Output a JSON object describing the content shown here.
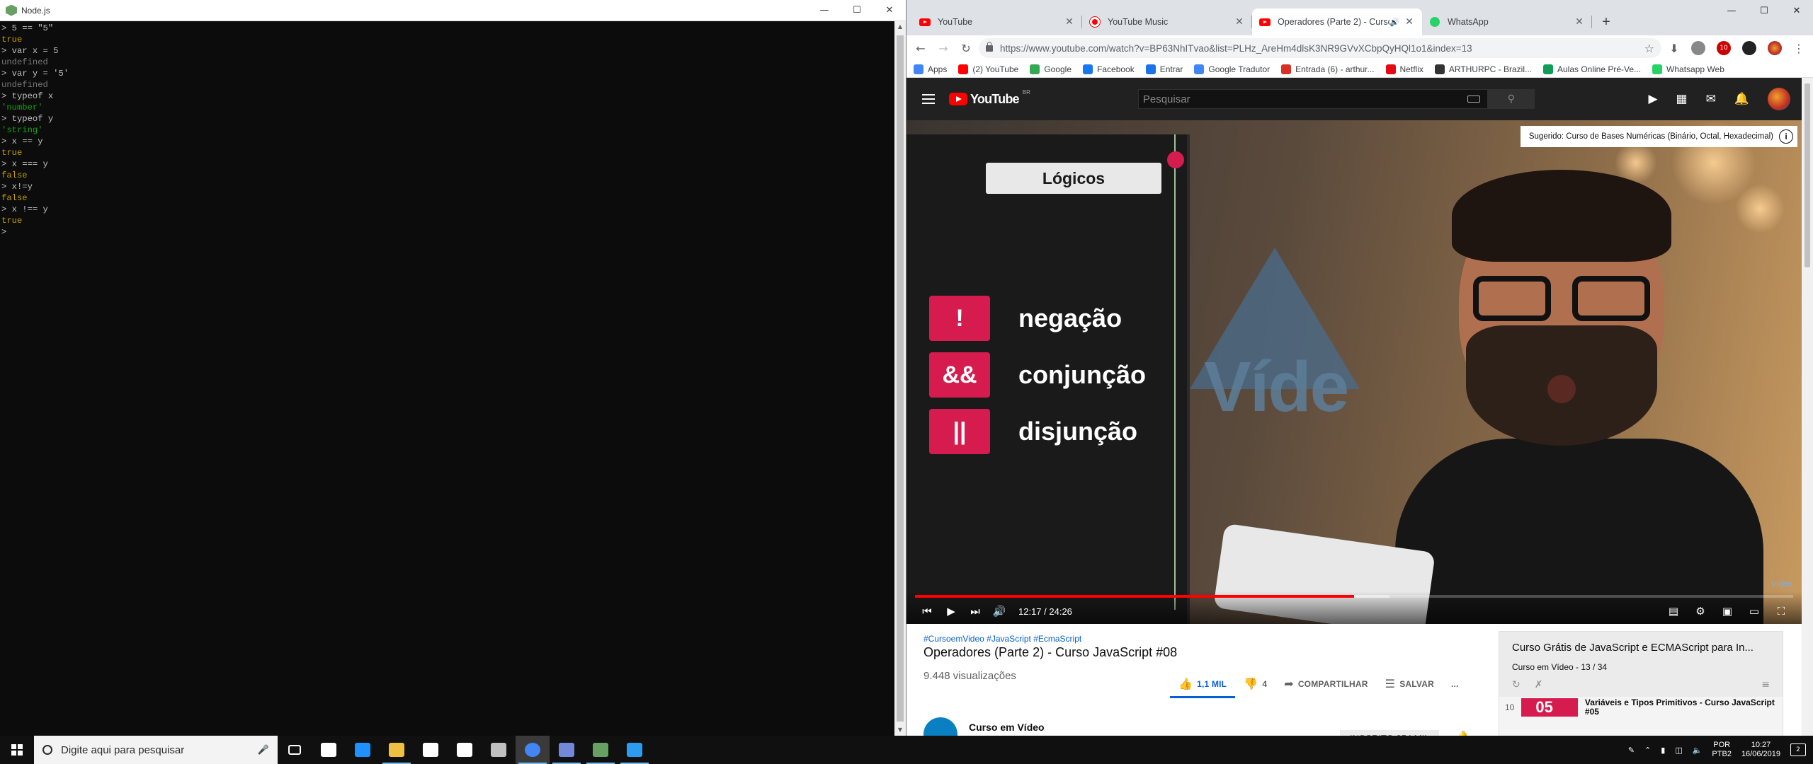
{
  "node": {
    "title": "Node.js",
    "lines": [
      {
        "text": "> 5 == \"5\"",
        "cls": ""
      },
      {
        "text": "true",
        "cls": "c-yellow"
      },
      {
        "text": "> var x = 5",
        "cls": ""
      },
      {
        "text": "undefined",
        "cls": "c-gray"
      },
      {
        "text": "> var y = '5'",
        "cls": ""
      },
      {
        "text": "undefined",
        "cls": "c-gray"
      },
      {
        "text": "> typeof x",
        "cls": ""
      },
      {
        "text": "'number'",
        "cls": "c-green"
      },
      {
        "text": "> typeof y",
        "cls": ""
      },
      {
        "text": "'string'",
        "cls": "c-green"
      },
      {
        "text": "> x == y",
        "cls": ""
      },
      {
        "text": "true",
        "cls": "c-yellow"
      },
      {
        "text": "> x === y",
        "cls": ""
      },
      {
        "text": "false",
        "cls": "c-yellow"
      },
      {
        "text": "> x!=y",
        "cls": ""
      },
      {
        "text": "false",
        "cls": "c-yellow"
      },
      {
        "text": "> x !== y",
        "cls": ""
      },
      {
        "text": "true",
        "cls": "c-yellow"
      },
      {
        "text": "> ",
        "cls": ""
      }
    ]
  },
  "chrome": {
    "tabs": [
      {
        "label": "YouTube",
        "fav": "yt"
      },
      {
        "label": "YouTube Music",
        "fav": "ytm"
      },
      {
        "label": "Operadores (Parte 2) - Curso JavaScript #08",
        "fav": "yt",
        "active": true
      },
      {
        "label": "WhatsApp",
        "fav": "wa"
      }
    ],
    "new_tab": "+",
    "url": "https://www.youtube.com/watch?v=BP63NhITvao&list=PLHz_AreHm4dlsK3NR9GVvXCbpQyHQl1o1&index=13",
    "bookmarks": [
      {
        "label": "Apps",
        "color": "#4285f4"
      },
      {
        "label": "(2) YouTube",
        "color": "#ff0000"
      },
      {
        "label": "Google",
        "color": "#34a853"
      },
      {
        "label": "Facebook",
        "color": "#1877f2"
      },
      {
        "label": "Entrar",
        "color": "#1a73e8"
      },
      {
        "label": "Google Tradutor",
        "color": "#4285f4"
      },
      {
        "label": "Entrada (6) - arthur...",
        "color": "#d93025"
      },
      {
        "label": "Netflix",
        "color": "#e50914"
      },
      {
        "label": "ARTHURPC - Brazil...",
        "color": "#333333"
      },
      {
        "label": "Aulas Online Pré-Ve...",
        "color": "#0f9d58"
      },
      {
        "label": "Whatsapp Web",
        "color": "#25d366"
      }
    ],
    "ext_badge": "10"
  },
  "youtube": {
    "logo": "YouTube",
    "logo_region": "BR",
    "search_placeholder": "Pesquisar",
    "suggest": "Sugerido: Curso de Bases Numéricas (Binário, Octal, Hexadecimal)",
    "slide": {
      "title": "Lógicos",
      "ops": [
        {
          "sym": "!",
          "label": "negação"
        },
        {
          "sym": "&&",
          "label": "conjunção"
        },
        {
          "sym": "||",
          "label": "disjunção"
        }
      ],
      "bg_text": "Víde",
      "watermark": "Vídeo"
    },
    "time": "12:17 / 24:26",
    "played_fraction": 0.5,
    "buffered_fraction": 0.54,
    "hashtags": "#CursoemVideo #JavaScript #EcmaScript",
    "title": "Operadores (Parte 2) - Curso JavaScript #08",
    "views": "9.448 visualizações",
    "likes": "1,1 MIL",
    "dislikes": "4",
    "share": "COMPARTILHAR",
    "save": "SALVAR",
    "more": "...",
    "channel": "Curso em Vídeo",
    "subscribe": "INSCRITO  854 MIL",
    "playlist": {
      "title": "Curso Grátis de JavaScript e ECMAScript para In...",
      "sub": "Curso em Vídeo - 13 / 34",
      "item_index": "10",
      "item_thumb": "05",
      "item_title": "Variáveis e Tipos Primitivos - Curso JavaScript #05"
    }
  },
  "taskbar": {
    "search_placeholder": "Digite aqui para pesquisar",
    "lang_top": "POR",
    "lang_bottom": "PTB2",
    "time": "10:27",
    "date": "16/06/2019",
    "notif_count": "2",
    "apps": [
      {
        "name": "task-view",
        "color": "#ffffff"
      },
      {
        "name": "notes",
        "color": "#ffffff"
      },
      {
        "name": "edge",
        "color": "#1e90ff"
      },
      {
        "name": "file-explorer",
        "color": "#f0c040"
      },
      {
        "name": "store",
        "color": "#ffffff"
      },
      {
        "name": "mail",
        "color": "#ffffff"
      },
      {
        "name": "utility",
        "color": "#c0c0c0"
      },
      {
        "name": "chrome",
        "color": "#4285f4"
      },
      {
        "name": "discord",
        "color": "#7289da"
      },
      {
        "name": "node",
        "color": "#68a063"
      },
      {
        "name": "vscode",
        "color": "#2d9bf0"
      }
    ]
  }
}
